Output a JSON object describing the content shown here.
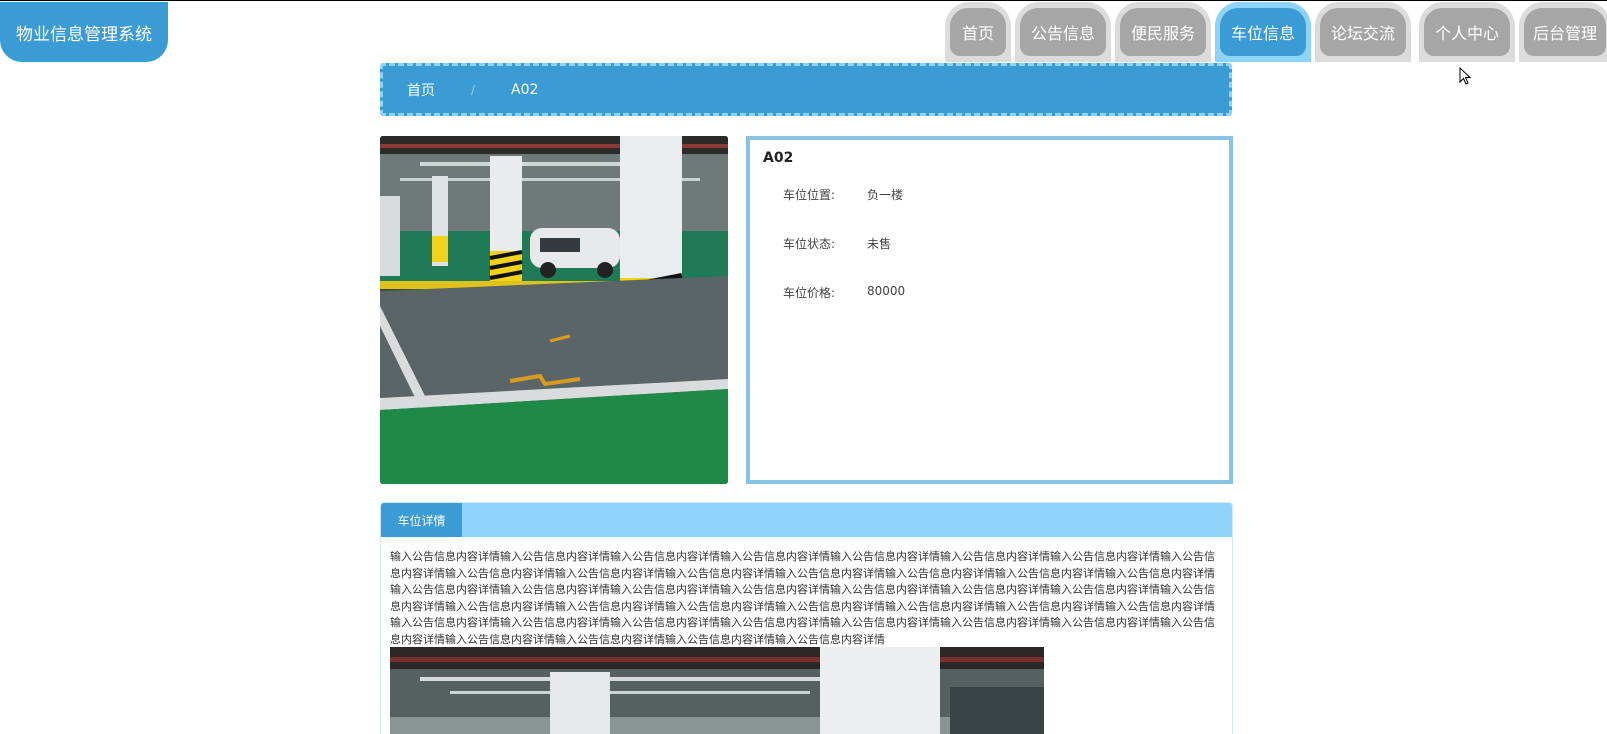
{
  "app": {
    "title": "物业信息管理系统"
  },
  "nav": {
    "items": [
      {
        "label": "首页"
      },
      {
        "label": "公告信息"
      },
      {
        "label": "便民服务"
      },
      {
        "label": "车位信息"
      },
      {
        "label": "论坛交流"
      },
      {
        "label": "个人中心"
      },
      {
        "label": "后台管理"
      }
    ]
  },
  "breadcrumb": {
    "home": "首页",
    "separator": "/",
    "current": "A02"
  },
  "parking": {
    "name": "A02",
    "fields": [
      {
        "label": "车位位置:",
        "value": "负一楼"
      },
      {
        "label": "车位状态:",
        "value": "未售"
      },
      {
        "label": "车位价格:",
        "value": "80000"
      }
    ]
  },
  "details": {
    "tab_label": "车位详情",
    "body": "输入公告信息内容详情输入公告信息内容详情输入公告信息内容详情输入公告信息内容详情输入公告信息内容详情输入公告信息内容详情输入公告信息内容详情输入公告信息内容详情输入公告信息内容详情输入公告信息内容详情输入公告信息内容详情输入公告信息内容详情输入公告信息内容详情输入公告信息内容详情输入公告信息内容详情输入公告信息内容详情输入公告信息内容详情输入公告信息内容详情输入公告信息内容详情输入公告信息内容详情输入公告信息内容详情输入公告信息内容详情输入公告信息内容详情输入公告信息内容详情输入公告信息内容详情输入公告信息内容详情输入公告信息内容详情输入公告信息内容详情输入公告信息内容详情输入公告信息内容详情输入公告信息内容详情输入公告信息内容详情输入公告信息内容详情输入公告信息内容详情输入公告信息内容详情输入公告信息内容详情输入公告信息内容详情输入公告信息内容详情输入公告信息内容详情输入公告信息内容详情输入公告信息内容详情输入公告信息内容详情"
  },
  "colors": {
    "primary": "#3a9bd5",
    "light": "#8ed3f9",
    "nav_inactive": "#a6a6a6",
    "nav_outer": "#dcdcdc"
  },
  "icons": {
    "cursor": "mouse-pointer-icon"
  }
}
